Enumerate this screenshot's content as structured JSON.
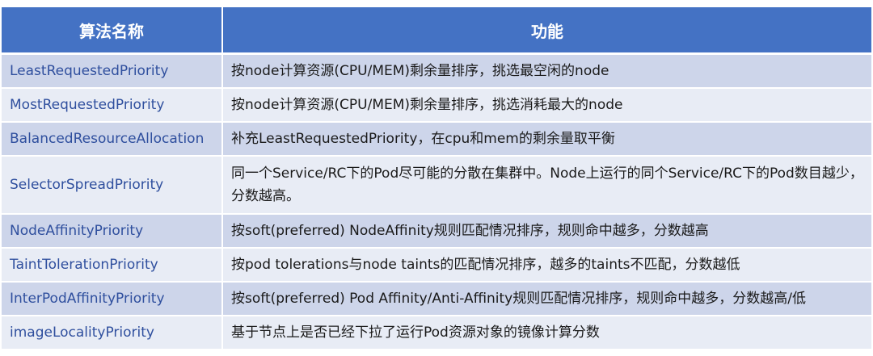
{
  "table": {
    "headers": [
      "算法名称",
      "功能"
    ],
    "rows": [
      {
        "name": "LeastRequestedPriority",
        "desc": "按node计算资源(CPU/MEM)剩余量排序，挑选最空闲的node"
      },
      {
        "name": "MostRequestedPriority",
        "desc": "按node计算资源(CPU/MEM)剩余量排序，挑选消耗最大的node"
      },
      {
        "name": "BalancedResourceAllocation",
        "desc": "补充LeastRequestedPriority，在cpu和mem的剩余量取平衡"
      },
      {
        "name": "SelectorSpreadPriority",
        "desc": "同一个Service/RC下的Pod尽可能的分散在集群中。Node上运行的同个Service/RC下的Pod数目越少，分数越高。"
      },
      {
        "name": "NodeAffinityPriority",
        "desc": "按soft(preferred) NodeAffinity规则匹配情况排序，规则命中越多，分数越高"
      },
      {
        "name": "TaintTolerationPriority",
        "desc": "按pod tolerations与node taints的匹配情况排序，越多的taints不匹配，分数越低"
      },
      {
        "name": "InterPodAffinityPriority",
        "desc": "按soft(preferred) Pod Affinity/Anti-Affinity规则匹配情况排序，规则命中越多，分数越高/低"
      },
      {
        "name": "imageLocalityPriority",
        "desc": "基于节点上是否已经下拉了运行Pod资源对象的镜像计算分数"
      }
    ]
  },
  "colors": {
    "header_bg": "#4472c4",
    "row_odd": "#cdd5ea",
    "row_even": "#e8ecf5",
    "name_text": "#2f4f9e"
  }
}
